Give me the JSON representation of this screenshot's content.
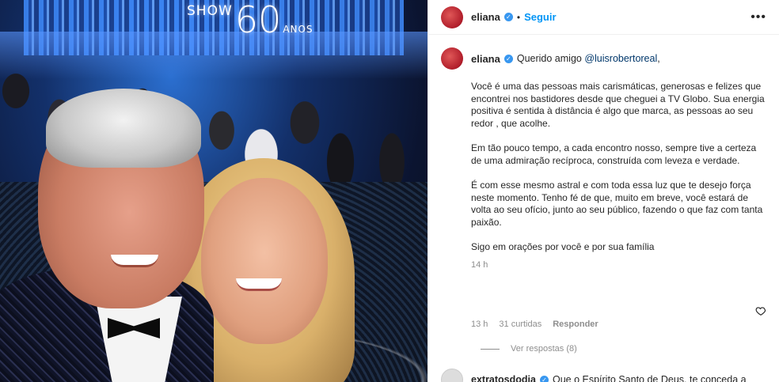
{
  "photo": {
    "logo_word": "SHOW",
    "logo_number": "60",
    "logo_suffix": "ANOS"
  },
  "header": {
    "username": "eliana",
    "separator": "•",
    "follow_label": "Seguir",
    "more_icon": "more-horizontal-icon"
  },
  "caption": {
    "username": "eliana",
    "greeting": "Querido amigo",
    "mention": "@luisrobertoreal",
    "mention_suffix": ",",
    "paragraphs": [
      "Você é uma das pessoas mais carismáticas, generosas e felizes que encontrei nos bastidores desde que cheguei a TV Globo. Sua energia positiva é sentida à distância é algo que marca, as pessoas ao seu redor , que acolhe.",
      "Em tão pouco tempo, a cada encontro nosso, sempre tive a certeza de uma admiração recíproca, construída com leveza e verdade.",
      "É com esse mesmo astral e com toda essa luz que te desejo força neste momento. Tenho fé de que, muito em breve, você estará de volta ao seu ofício, junto ao seu público, fazendo o que faz com tanta paixão.",
      "Sigo em orações por você e por sua família"
    ],
    "time": "14 h"
  },
  "comment_meta": {
    "time": "13 h",
    "likes": "31 curtidas",
    "reply": "Responder",
    "view_replies": "Ver respostas (8)"
  },
  "next_comment": {
    "username": "extratosdodia",
    "text": "Que o Espírito Santo de Deus, te conceda a"
  },
  "colors": {
    "link_blue": "#0095f6",
    "mention": "#00376b",
    "muted": "#8e8e8e",
    "verified": "#3897f0"
  }
}
